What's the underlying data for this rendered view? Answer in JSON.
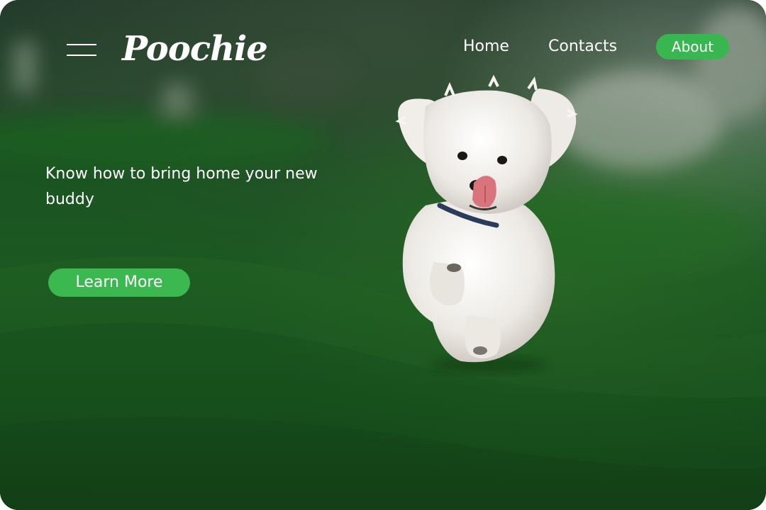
{
  "header": {
    "brand": "Poochie",
    "menu_icon": "hamburger-menu-icon",
    "nav": {
      "home": "Home",
      "contacts": "Contacts",
      "about": "About"
    }
  },
  "hero": {
    "headline": "Know how to bring home your new buddy",
    "cta_label": "Learn More",
    "photo_subject": "white fluffy puppy running on green grass"
  },
  "colors": {
    "accent_green": "#38b751",
    "text": "#ffffff",
    "background_green": "#1f4d22"
  }
}
